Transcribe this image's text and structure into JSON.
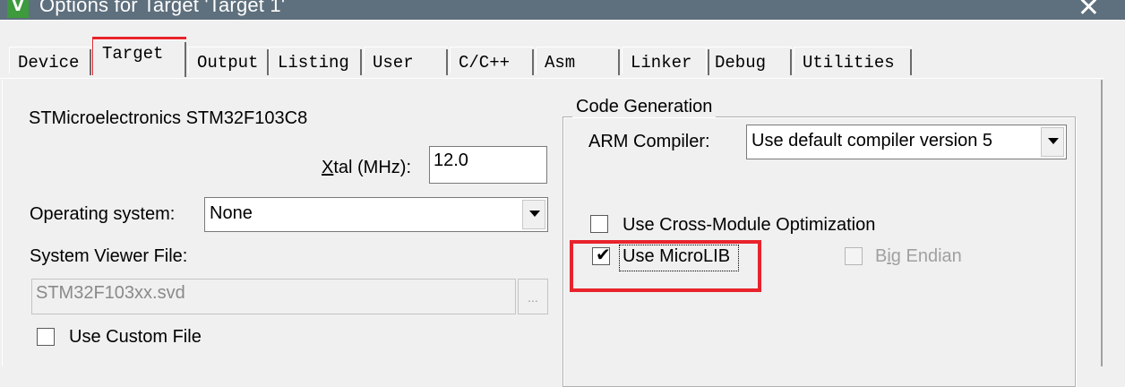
{
  "window": {
    "icon_letter": "V",
    "title": "Options for Target 'Target 1'",
    "close_glyph": "✕"
  },
  "tabs": [
    {
      "label": "Device"
    },
    {
      "label": "Target",
      "active": true
    },
    {
      "label": "Output"
    },
    {
      "label": "Listing"
    },
    {
      "label": "User"
    },
    {
      "label": "C/C++"
    },
    {
      "label": "Asm"
    },
    {
      "label": "Linker"
    },
    {
      "label": "Debug"
    },
    {
      "label": "Utilities"
    }
  ],
  "target": {
    "device_name": "STMicroelectronics STM32F103C8",
    "xtal": {
      "label_first": "X",
      "label_rest": "tal (MHz):",
      "value": "12.0"
    },
    "os": {
      "label": "Operating system:",
      "value": "None"
    },
    "system_viewer": {
      "label": "System Viewer File:",
      "value": "STM32F103xx.svd",
      "browse_label": "..."
    },
    "use_custom_file": {
      "label": "Use Custom File",
      "checked": false
    }
  },
  "code_generation": {
    "title": "Code Generation",
    "compiler_label": "ARM Compiler:",
    "compiler_value": "Use default compiler version 5",
    "cross_module": {
      "label": "Use Cross-Module Optimization",
      "checked": false
    },
    "microlib": {
      "label": "Use MicroLIB",
      "checked": true
    },
    "big_endian": {
      "label_pre": "B",
      "label_ul": "i",
      "label_post": "g Endian",
      "checked": false,
      "enabled": false
    }
  },
  "colors": {
    "highlight": "#e8232b",
    "titlebar": "#5e6f7d"
  }
}
